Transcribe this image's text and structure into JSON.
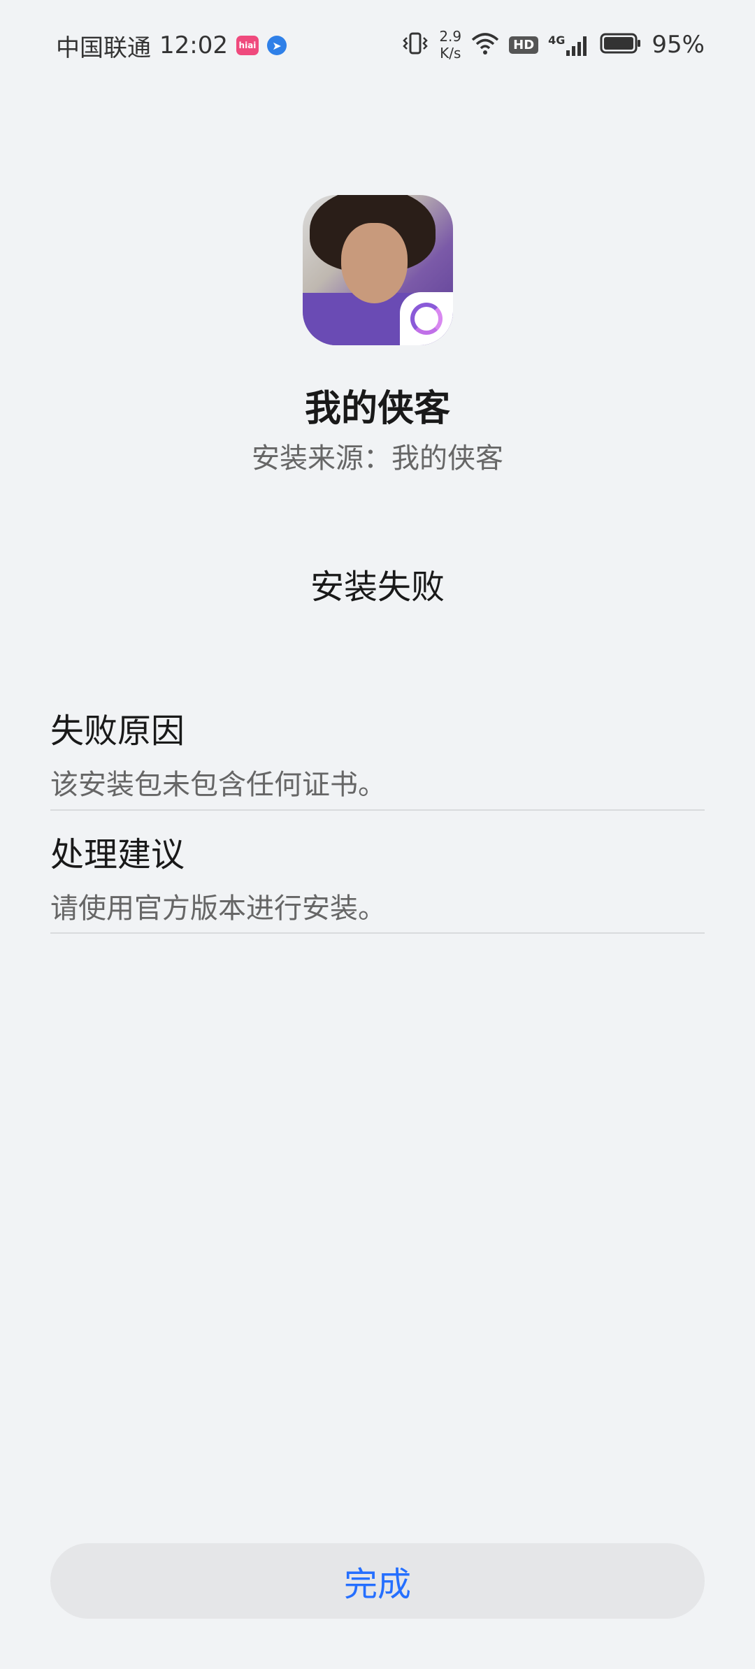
{
  "status_bar": {
    "carrier": "中国联通",
    "time": "12:02",
    "app_badge_text": "hiai",
    "net_speed_value": "2.9",
    "net_speed_unit": "K/s",
    "hd_label": "HD",
    "network_type": "4G",
    "battery_percent": "95%"
  },
  "app": {
    "name": "我的侠客",
    "install_source": "安装来源：我的侠客",
    "status": "安装失败"
  },
  "failure_reason": {
    "title": "失败原因",
    "detail": "该安装包未包含任何证书。"
  },
  "suggestion": {
    "title": "处理建议",
    "detail": "请使用官方版本进行安装。"
  },
  "done_button_label": "完成",
  "colors": {
    "background": "#f1f3f5",
    "accent": "#256fff",
    "button_bg": "#e5e6e8"
  }
}
